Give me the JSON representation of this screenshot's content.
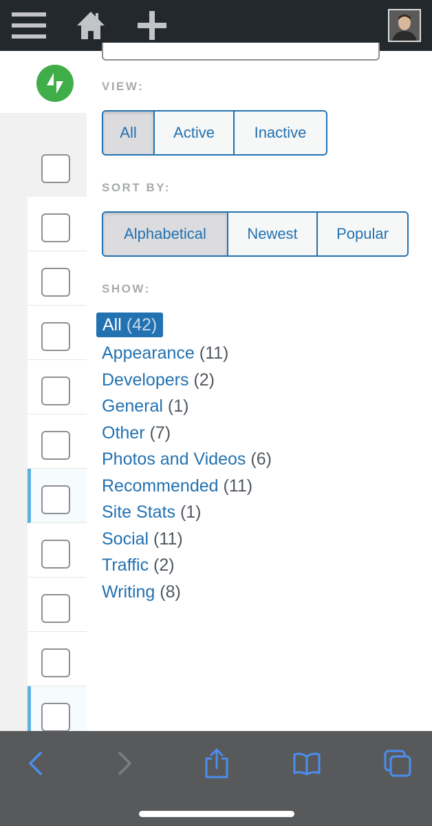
{
  "panel": {
    "view": {
      "label": "VIEW:",
      "options": [
        "All",
        "Active",
        "Inactive"
      ],
      "selected": "All"
    },
    "sort": {
      "label": "SORT BY:",
      "options": [
        "Alphabetical",
        "Newest",
        "Popular"
      ],
      "selected": "Alphabetical"
    },
    "show": {
      "label": "SHOW:",
      "items": [
        {
          "name": "All",
          "count": "(42)"
        },
        {
          "name": "Appearance",
          "count": "(11)"
        },
        {
          "name": "Developers",
          "count": "(2)"
        },
        {
          "name": "General",
          "count": "(1)"
        },
        {
          "name": "Other",
          "count": "(7)"
        },
        {
          "name": "Photos and Videos",
          "count": "(6)"
        },
        {
          "name": "Recommended",
          "count": "(11)"
        },
        {
          "name": "Site Stats",
          "count": "(1)"
        },
        {
          "name": "Social",
          "count": "(11)"
        },
        {
          "name": "Traffic",
          "count": "(2)"
        },
        {
          "name": "Writing",
          "count": "(8)"
        }
      ]
    }
  },
  "icons": {
    "menu": "hamburger-menu-icon",
    "home": "home-icon",
    "add": "plus-icon",
    "back": "chevron-left-icon",
    "forward": "chevron-right-icon",
    "share": "share-icon",
    "bookmarks": "book-icon",
    "tabs": "tabs-icon"
  },
  "colors": {
    "accent": "#2271b1",
    "admin_bar": "#23282d",
    "jetpack_green": "#3fae49",
    "safari_icon": "#4a8ef0"
  }
}
